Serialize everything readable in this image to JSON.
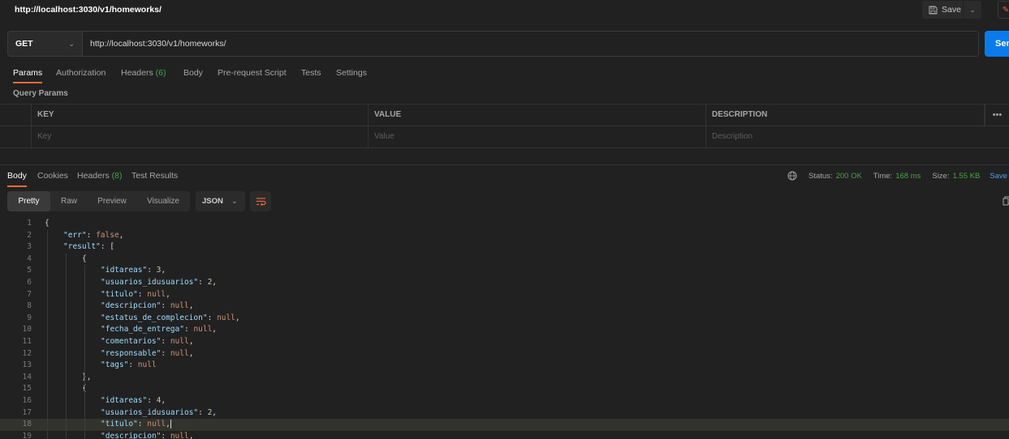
{
  "header": {
    "title": "http://localhost:3030/v1/homeworks/",
    "save_label": "Save"
  },
  "request": {
    "method": "GET",
    "url": "http://localhost:3030/v1/homeworks/",
    "send_label": "Send"
  },
  "request_tabs": [
    {
      "label": "Params",
      "count": ""
    },
    {
      "label": "Authorization",
      "count": ""
    },
    {
      "label": "Headers",
      "count": "(6)"
    },
    {
      "label": "Body",
      "count": ""
    },
    {
      "label": "Pre-request Script",
      "count": ""
    },
    {
      "label": "Tests",
      "count": ""
    },
    {
      "label": "Settings",
      "count": ""
    }
  ],
  "query_params": {
    "label": "Query Params",
    "headers": [
      "KEY",
      "VALUE",
      "DESCRIPTION"
    ],
    "placeholders": [
      "Key",
      "Value",
      "Description"
    ]
  },
  "response_tabs": [
    {
      "label": "Body",
      "count": ""
    },
    {
      "label": "Cookies",
      "count": ""
    },
    {
      "label": "Headers",
      "count": "(8)"
    },
    {
      "label": "Test Results",
      "count": ""
    }
  ],
  "response_status": {
    "status_label": "Status:",
    "status_value": "200 OK",
    "time_label": "Time:",
    "time_value": "168 ms",
    "size_label": "Size:",
    "size_value": "1.55 KB",
    "save_response_label": "Save Response"
  },
  "view_modes": [
    "Pretty",
    "Raw",
    "Preview",
    "Visualize"
  ],
  "format": "JSON",
  "code_lines": [
    {
      "n": "1",
      "indent": 0,
      "tokens": [
        {
          "t": "p",
          "v": "{"
        }
      ]
    },
    {
      "n": "2",
      "indent": 1,
      "tokens": [
        {
          "t": "k",
          "v": "\"err\""
        },
        {
          "t": "p",
          "v": ": "
        },
        {
          "t": "z",
          "v": "false"
        },
        {
          "t": "p",
          "v": ","
        }
      ]
    },
    {
      "n": "3",
      "indent": 1,
      "tokens": [
        {
          "t": "k",
          "v": "\"result\""
        },
        {
          "t": "p",
          "v": ": ["
        }
      ]
    },
    {
      "n": "4",
      "indent": 2,
      "tokens": [
        {
          "t": "p",
          "v": "{"
        }
      ]
    },
    {
      "n": "5",
      "indent": 3,
      "tokens": [
        {
          "t": "k",
          "v": "\"idtareas\""
        },
        {
          "t": "p",
          "v": ": "
        },
        {
          "t": "n",
          "v": "3"
        },
        {
          "t": "p",
          "v": ","
        }
      ]
    },
    {
      "n": "6",
      "indent": 3,
      "tokens": [
        {
          "t": "k",
          "v": "\"usuarios_idusuarios\""
        },
        {
          "t": "p",
          "v": ": "
        },
        {
          "t": "n",
          "v": "2"
        },
        {
          "t": "p",
          "v": ","
        }
      ]
    },
    {
      "n": "7",
      "indent": 3,
      "tokens": [
        {
          "t": "k",
          "v": "\"titulo\""
        },
        {
          "t": "p",
          "v": ": "
        },
        {
          "t": "z",
          "v": "null"
        },
        {
          "t": "p",
          "v": ","
        }
      ]
    },
    {
      "n": "8",
      "indent": 3,
      "tokens": [
        {
          "t": "k",
          "v": "\"descripcion\""
        },
        {
          "t": "p",
          "v": ": "
        },
        {
          "t": "z",
          "v": "null"
        },
        {
          "t": "p",
          "v": ","
        }
      ]
    },
    {
      "n": "9",
      "indent": 3,
      "tokens": [
        {
          "t": "k",
          "v": "\"estatus_de_complecion\""
        },
        {
          "t": "p",
          "v": ": "
        },
        {
          "t": "z",
          "v": "null"
        },
        {
          "t": "p",
          "v": ","
        }
      ]
    },
    {
      "n": "10",
      "indent": 3,
      "tokens": [
        {
          "t": "k",
          "v": "\"fecha_de_entrega\""
        },
        {
          "t": "p",
          "v": ": "
        },
        {
          "t": "z",
          "v": "null"
        },
        {
          "t": "p",
          "v": ","
        }
      ]
    },
    {
      "n": "11",
      "indent": 3,
      "tokens": [
        {
          "t": "k",
          "v": "\"comentarios\""
        },
        {
          "t": "p",
          "v": ": "
        },
        {
          "t": "z",
          "v": "null"
        },
        {
          "t": "p",
          "v": ","
        }
      ]
    },
    {
      "n": "12",
      "indent": 3,
      "tokens": [
        {
          "t": "k",
          "v": "\"responsable\""
        },
        {
          "t": "p",
          "v": ": "
        },
        {
          "t": "z",
          "v": "null"
        },
        {
          "t": "p",
          "v": ","
        }
      ]
    },
    {
      "n": "13",
      "indent": 3,
      "tokens": [
        {
          "t": "k",
          "v": "\"tags\""
        },
        {
          "t": "p",
          "v": ": "
        },
        {
          "t": "z",
          "v": "null"
        }
      ]
    },
    {
      "n": "14",
      "indent": 2,
      "tokens": [
        {
          "t": "p",
          "v": "},"
        }
      ]
    },
    {
      "n": "15",
      "indent": 2,
      "tokens": [
        {
          "t": "p",
          "v": "{"
        }
      ]
    },
    {
      "n": "16",
      "indent": 3,
      "tokens": [
        {
          "t": "k",
          "v": "\"idtareas\""
        },
        {
          "t": "p",
          "v": ": "
        },
        {
          "t": "n",
          "v": "4"
        },
        {
          "t": "p",
          "v": ","
        }
      ]
    },
    {
      "n": "17",
      "indent": 3,
      "tokens": [
        {
          "t": "k",
          "v": "\"usuarios_idusuarios\""
        },
        {
          "t": "p",
          "v": ": "
        },
        {
          "t": "n",
          "v": "2"
        },
        {
          "t": "p",
          "v": ","
        }
      ]
    },
    {
      "n": "18",
      "indent": 3,
      "highlight": true,
      "tokens": [
        {
          "t": "k",
          "v": "\"titulo\""
        },
        {
          "t": "p",
          "v": ": "
        },
        {
          "t": "z",
          "v": "null"
        },
        {
          "t": "p",
          "v": ","
        }
      ]
    },
    {
      "n": "19",
      "indent": 3,
      "tokens": [
        {
          "t": "k",
          "v": "\"descripcion\""
        },
        {
          "t": "p",
          "v": ": "
        },
        {
          "t": "z",
          "v": "null"
        },
        {
          "t": "p",
          "v": ","
        }
      ]
    }
  ],
  "colors": {
    "accent": "#f26b3a",
    "send": "#097bed",
    "status_ok": "#48a348",
    "json_key": "#9cdcfe",
    "json_number": "#b5cea8",
    "json_literal": "#ce9178"
  }
}
